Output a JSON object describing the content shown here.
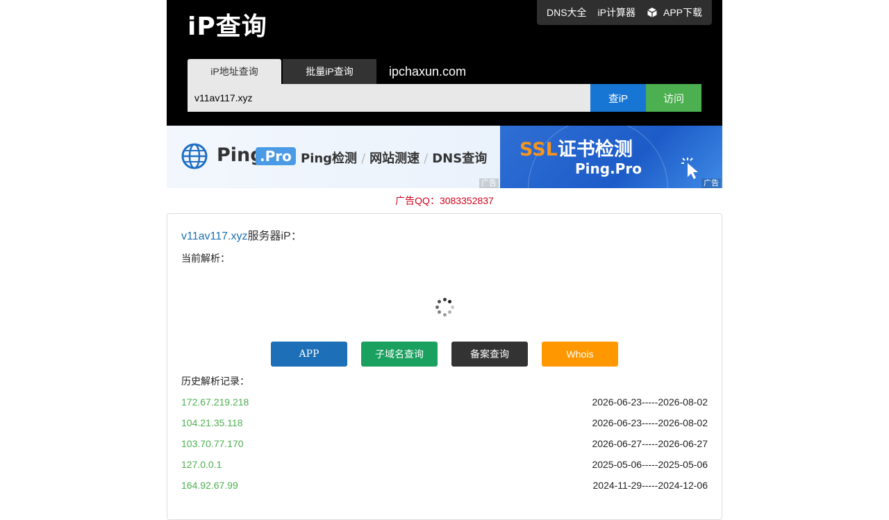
{
  "header": {
    "logo": "iP查询",
    "topnav": [
      "DNS大全",
      "iP计算器",
      "APP下载"
    ],
    "tabs": [
      "iP地址查询",
      "批量iP查询"
    ],
    "domain": "ipchaxun.com",
    "search": {
      "value": "v11av117.xyz",
      "query_label": "查iP",
      "visit_label": "访问"
    }
  },
  "ads": {
    "left": {
      "brand": "Ping",
      "badge": ".Pro",
      "features": [
        "Ping检测",
        "网站测速",
        "DNS查询"
      ],
      "tag": "广告"
    },
    "right": {
      "title_prefix": "SSL",
      "title_rest": "证书检测",
      "subtitle": "Ping.Pro",
      "tag": "广告"
    },
    "qq": "广告QQ：3083352837"
  },
  "result": {
    "domain": "v11av117.xyz",
    "title_suffix": "服务器iP：",
    "current_label": "当前解析：",
    "buttons": [
      "APP",
      "子域名查询",
      "备案查询",
      "Whois"
    ],
    "history_label": "历史解析记录：",
    "history": [
      {
        "ip": "172.67.219.218",
        "range": "2026-06-23-----2026-08-02"
      },
      {
        "ip": "104.21.35.118",
        "range": "2026-06-23-----2026-08-02"
      },
      {
        "ip": "103.70.77.170",
        "range": "2026-06-27-----2026-06-27"
      },
      {
        "ip": "127.0.0.1",
        "range": "2025-05-06-----2025-05-06"
      },
      {
        "ip": "164.92.67.99",
        "range": "2024-11-29-----2024-12-06"
      }
    ]
  },
  "colors": {
    "accent_blue": "#1775d3",
    "accent_green": "#4caf50",
    "whois_orange": "#ff9800",
    "qq_red": "#d0021b"
  }
}
